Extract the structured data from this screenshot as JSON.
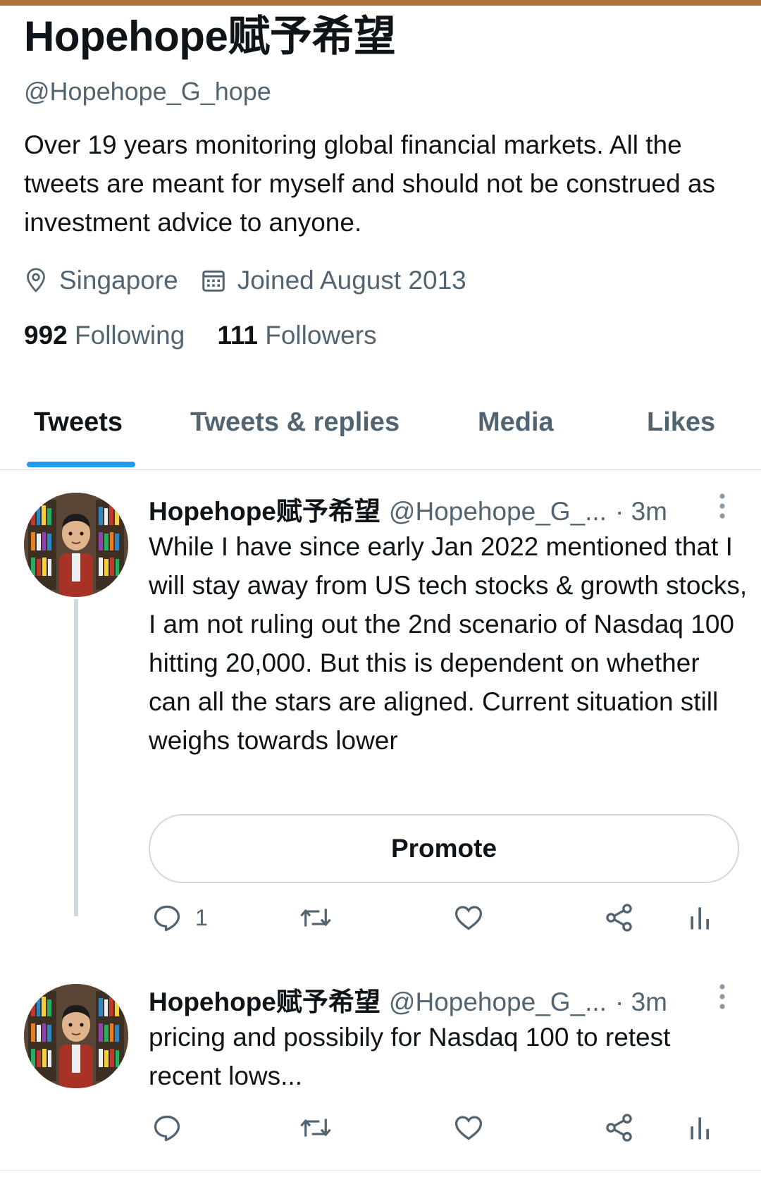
{
  "profile": {
    "display_name": "Hopehope赋予希望",
    "handle": "@Hopehope_G_hope",
    "bio": "Over 19 years monitoring global financial markets.  All the tweets are meant for myself and should not be construed as investment advice to anyone.",
    "location": "Singapore",
    "joined": "Joined August 2013",
    "following_count": "992",
    "following_label": "Following",
    "followers_count": "111",
    "followers_label": "Followers"
  },
  "tabs": [
    {
      "label": "Tweets",
      "active": true
    },
    {
      "label": "Tweets & replies"
    },
    {
      "label": "Media"
    },
    {
      "label": "Likes"
    }
  ],
  "tweets": [
    {
      "name": "Hopehope赋予希望",
      "handle": "@Hopehope_G_...",
      "time": "· 3m",
      "text": "While I have since early Jan 2022 mentioned that I will stay away from US tech stocks & growth stocks, I am not ruling out the 2nd scenario of Nasdaq 100 hitting 20,000. But this is dependent on whether can all the stars are aligned. Current situation still weighs towards lower",
      "promote_label": "Promote",
      "reply_count": "1"
    },
    {
      "name": "Hopehope赋予希望",
      "handle": "@Hopehope_G_...",
      "time": "· 3m",
      "text": "pricing and possibily for Nasdaq 100 to retest recent lows...",
      "reply_count": ""
    }
  ],
  "icons": {
    "location": "location-pin-icon",
    "calendar": "calendar-icon",
    "reply": "reply-icon",
    "retweet": "retweet-icon",
    "like": "heart-icon",
    "share": "share-icon",
    "analytics": "analytics-icon",
    "more": "more-vertical-icon"
  },
  "colors": {
    "accent": "#1d9bf0",
    "secondary_text": "#536471",
    "top_bar": "#a8743b"
  }
}
